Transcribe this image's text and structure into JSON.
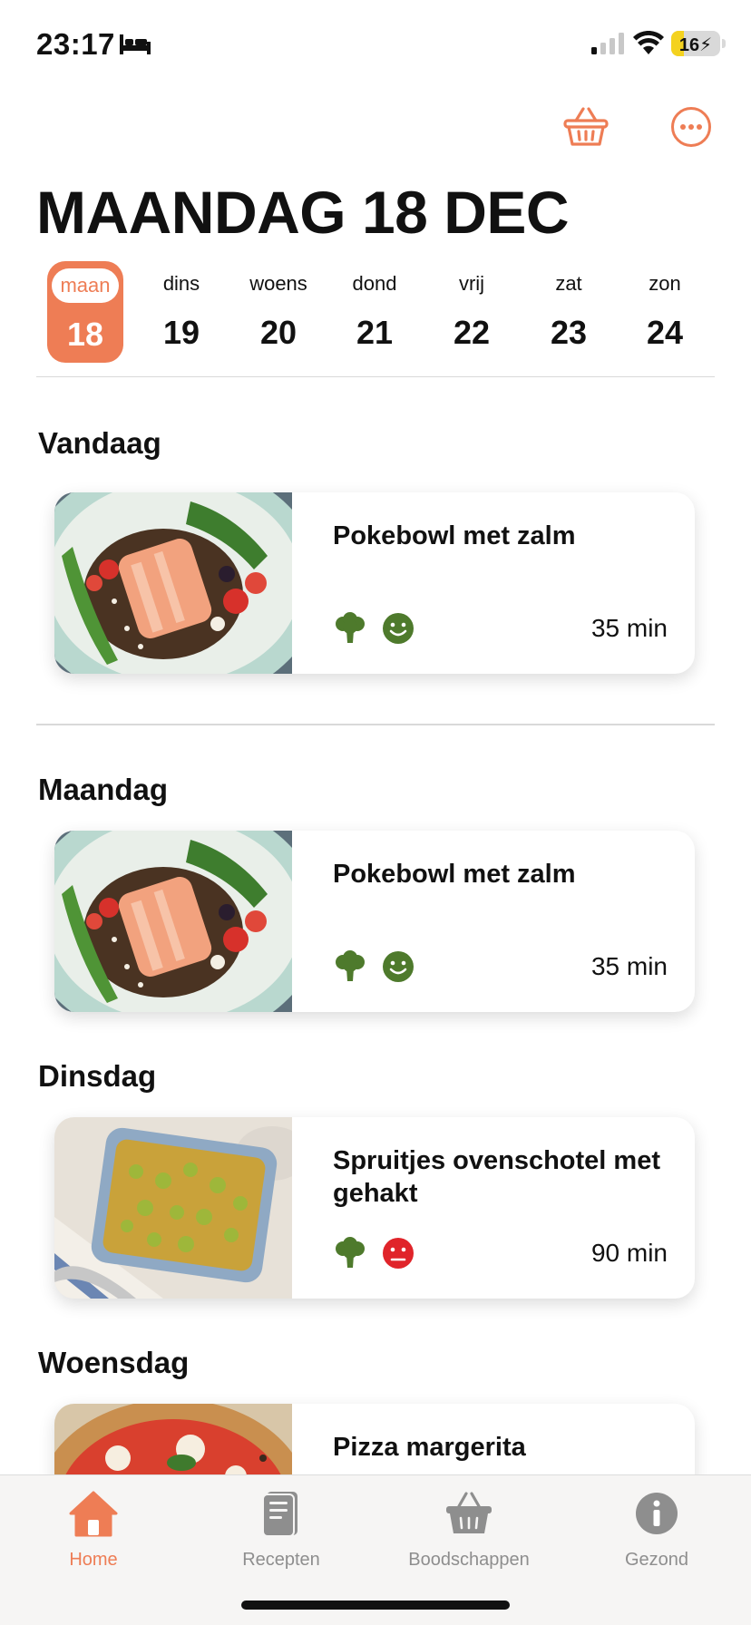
{
  "status_bar": {
    "time": "23:17",
    "battery": "16",
    "battery_level_percent": 16
  },
  "header": {
    "title": "MAANDAG 18 DEC",
    "basket_icon": "basket-icon",
    "more_icon": "more-circle-icon"
  },
  "week": {
    "days": [
      {
        "name": "maan",
        "num": "18",
        "active": true
      },
      {
        "name": "dins",
        "num": "19"
      },
      {
        "name": "woens",
        "num": "20"
      },
      {
        "name": "dond",
        "num": "21"
      },
      {
        "name": "vrij",
        "num": "22"
      },
      {
        "name": "zat",
        "num": "23"
      },
      {
        "name": "zon",
        "num": "24"
      }
    ]
  },
  "today": {
    "heading": "Vandaag",
    "recipe": {
      "title": "Pokebowl met zalm",
      "time": "35 min",
      "veggie_icon": "broccoli-icon",
      "mood_icon": "happy-face-icon"
    }
  },
  "week_list": [
    {
      "heading": "Maandag",
      "recipe": {
        "title": "Pokebowl met zalm",
        "time": "35 min",
        "veggie_icon": "broccoli-icon",
        "mood_icon": "happy-face-icon"
      }
    },
    {
      "heading": "Dinsdag",
      "recipe": {
        "title": "Spruitjes ovenschotel met gehakt",
        "time": "90 min",
        "veggie_icon": "broccoli-icon",
        "mood_icon": "sad-face-icon"
      }
    },
    {
      "heading": "Woensdag",
      "recipe": {
        "title": "Pizza margerita"
      }
    }
  ],
  "tabbar": {
    "tabs": [
      {
        "label": "Home",
        "icon": "home-icon",
        "active": true
      },
      {
        "label": "Recepten",
        "icon": "book-icon"
      },
      {
        "label": "Boodschappen",
        "icon": "basket-icon"
      },
      {
        "label": "Gezond",
        "icon": "info-icon"
      }
    ]
  },
  "colors": {
    "accent": "#ee7d55",
    "green": "#4e7a2c",
    "red": "#e0242a",
    "inactive": "#8e8e8e"
  }
}
